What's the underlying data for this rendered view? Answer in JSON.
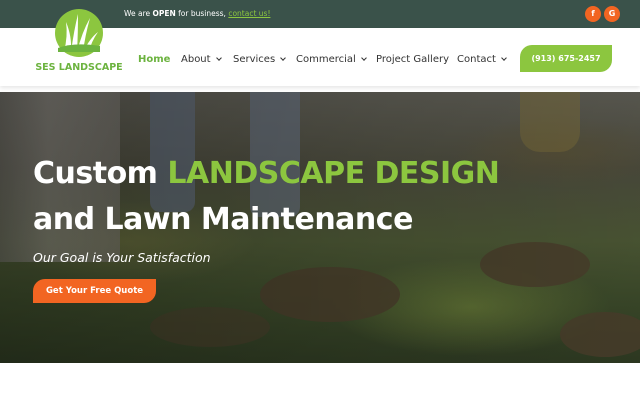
{
  "topbar": {
    "msg_prefix": "We are ",
    "msg_open": "OPEN",
    "msg_middle": " for business, ",
    "msg_link": "contact us!",
    "social": [
      {
        "label": "f",
        "icon": "facebook-icon"
      },
      {
        "label": "G",
        "icon": "google-icon"
      }
    ]
  },
  "logo": {
    "text": "SES LANDSCAPE"
  },
  "nav": {
    "items": [
      {
        "label": "Home",
        "active": true
      },
      {
        "label": "About"
      },
      {
        "label": "Services"
      },
      {
        "label": "Commercial"
      },
      {
        "label": "Project Gallery"
      },
      {
        "label": "Contact"
      }
    ],
    "phone": "(913) 675-2457"
  },
  "hero": {
    "line1_prefix": "Custom ",
    "line1_highlight": "LANDSCAPE DESIGN",
    "line2": "and Lawn Maintenance",
    "tagline": "Our Goal is Your Satisfaction",
    "cta": "Get Your Free Quote"
  },
  "colors": {
    "topbar": "#3a524a",
    "brand_green": "#8cc63f",
    "accent_orange": "#f26522"
  }
}
